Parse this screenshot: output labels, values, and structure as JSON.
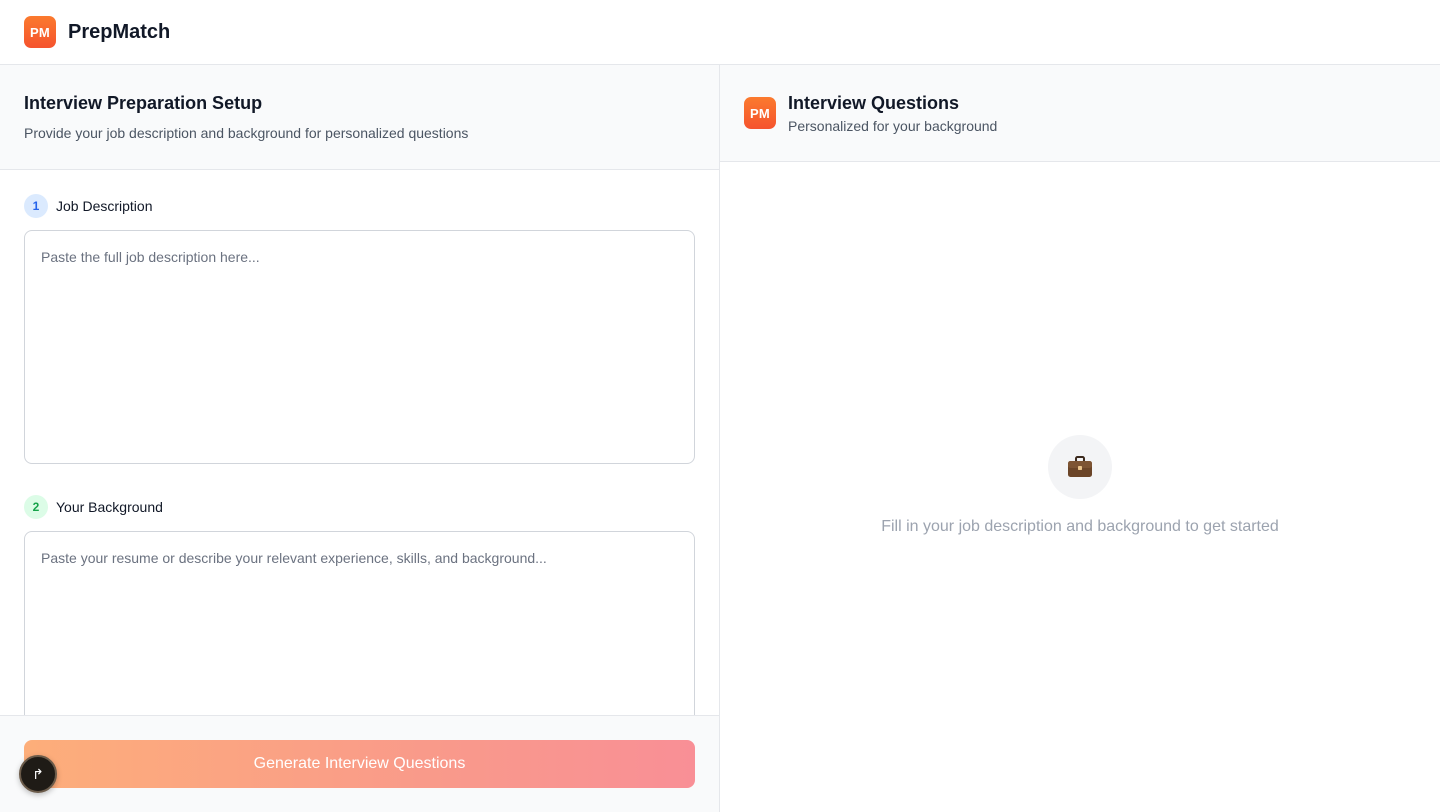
{
  "header": {
    "logo_text": "PM",
    "app_name": "PrepMatch"
  },
  "setup": {
    "title": "Interview Preparation Setup",
    "subtitle": "Provide your job description and background for personalized questions",
    "steps": [
      {
        "number": "1",
        "label": "Job Description",
        "value": "",
        "placeholder": "Paste the full job description here...",
        "accent": "#2563eb"
      },
      {
        "number": "2",
        "label": "Your Background",
        "value": "",
        "placeholder": "Paste your resume or describe your relevant experience, skills, and background...",
        "accent": "#16a34a"
      }
    ],
    "generate_label": "Generate Interview Questions"
  },
  "questions": {
    "logo_text": "PM",
    "title": "Interview Questions",
    "subtitle": "Personalized for your background",
    "empty_icon": "briefcase-icon",
    "empty_message": "Fill in your job description and background to get started"
  },
  "colors": {
    "brand": "#f5532e",
    "button_gradient_start": "#fdae7a",
    "button_gradient_end": "#f98f96"
  }
}
